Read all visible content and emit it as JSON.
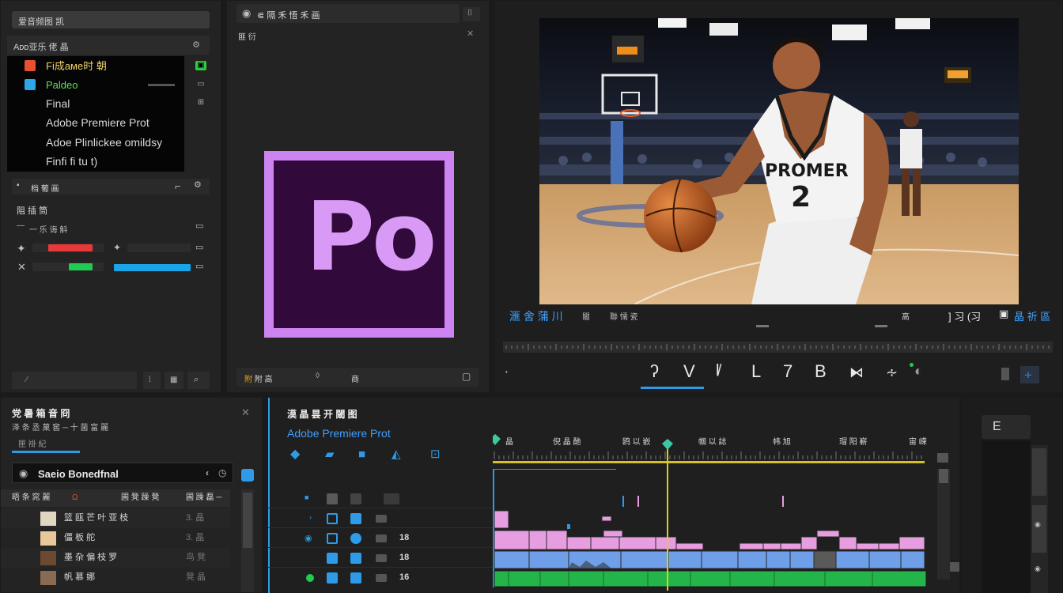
{
  "project_panel": {
    "search_placeholder": "爱音频图 凯",
    "bin_header": "Aᴅᴅ亚乐 佬 晶",
    "bins": [
      {
        "label": "Fi成aᴍe时 朝",
        "color": "#e8502e",
        "text_color": "#f0d36b"
      },
      {
        "label": "Paldeo",
        "color": "#2ea6e8",
        "text_color": "#5ce05c"
      },
      {
        "label": "Final",
        "color": "",
        "text_color": "#e8e8e8"
      },
      {
        "label": "Adobe Premiere Prot",
        "color": "",
        "text_color": "#e8e8e8"
      },
      {
        "label": "Adoe Plinlickee omildsy",
        "color": "",
        "text_color": "#e8e8e8"
      },
      {
        "label": "Finfi fi tu t)",
        "color": "",
        "text_color": "#e8e8e8"
      }
    ],
    "toolbar_label": "档 葡 画",
    "section_title": "阻 插 筒",
    "sub_label": "一 乐 诲 斛",
    "bottom_left": "⁄",
    "colors": {
      "red": "#e8383a",
      "green": "#20cc50",
      "blue": "#1aa5e8"
    }
  },
  "middle_panel": {
    "tab_title": "⋐ 隔 禾 悟 禾 画",
    "subtitle": "匪 衍",
    "logo_text": "Po",
    "bottom_label": "附 高",
    "bottom_label2": "商"
  },
  "program_monitor": {
    "jersey_text": "PROMER",
    "jersey_number": "2",
    "left_label": "滙 舍 蒲 川",
    "mid_label": "閽",
    "mid_label2": "聯 懦 瓷",
    "right_num": "高",
    "timecode": "] 习 (习",
    "right_label": "晶 祈 區",
    "controls": [
      "ʔ",
      "V",
      "Ɩ̸",
      "L",
      "7",
      "B",
      "⧑",
      "∻"
    ]
  },
  "effects_panel": {
    "title": "党 暑 箱 音 冏",
    "subtitle": "泽 条 丞 菓 窖 ─ 十 菌 富 麗",
    "tab": "匣 褂 紀",
    "search_value": "Saeio Bonedfnal",
    "columns": [
      "晤 条 窕 麗",
      "圃 凳 躁 凳",
      "圃 躁 磊 ─"
    ],
    "rows": [
      "篮 瓯 芒 叶 亚 枝",
      "僵 板 舵",
      "墨 杂 偏 枝 罗",
      "帆 慕 娜"
    ],
    "row_vals": [
      "3. 晶",
      "3. 晶",
      "鸟 凳",
      "凳 晶"
    ]
  },
  "timeline": {
    "title": "漠 晶 昙 开 閾 图",
    "sequence_name": "Adobe Premiere Prot",
    "ruler_labels": [
      "晶",
      "倪 晶 酏",
      "鸥 以 嵌",
      "帼 以 誌",
      "帏 旭",
      "瑁 阳 嶄",
      "宙 嵘"
    ],
    "track_nums": [
      "",
      "",
      "18",
      "18",
      "16"
    ]
  },
  "far_right": {
    "label": "E"
  }
}
